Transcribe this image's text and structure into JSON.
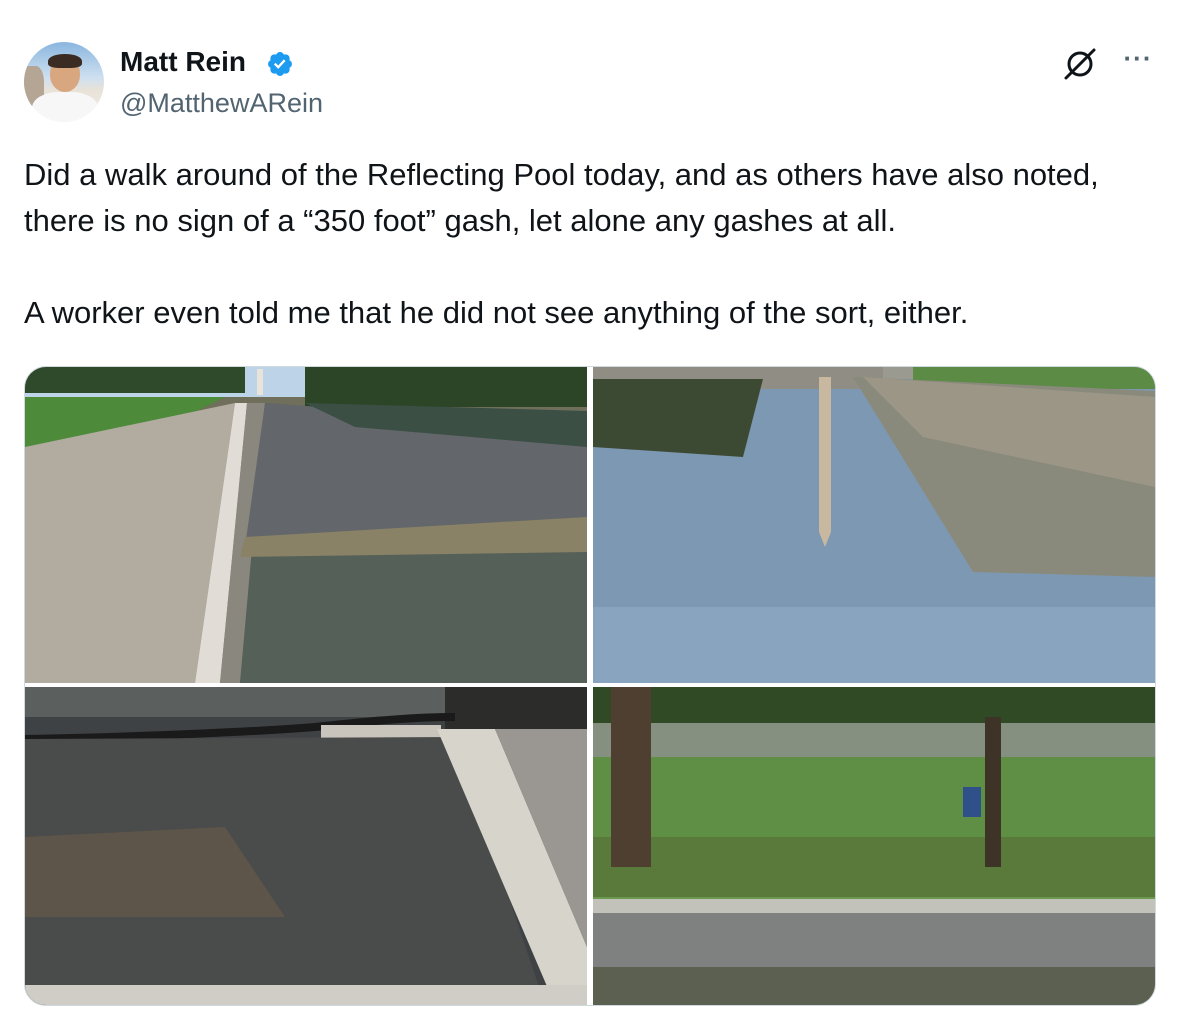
{
  "author": {
    "name": "Matt Rein",
    "handle": "@MatthewARein",
    "verified": true,
    "avatar_icon": "avatar"
  },
  "post": {
    "paragraphs": [
      "Did a walk around of the Reflecting Pool today, and as others have also noted, there is no sign of a “350 foot” gash, let alone any gashes at all.",
      "A worker even told me that he did not see anything of the sort, either."
    ]
  },
  "icons": {
    "verified": "verified-badge-icon",
    "grok": "grok-icon",
    "more": "more-options-icon"
  },
  "colors": {
    "text": "#0f1419",
    "secondary": "#536471",
    "verified_blue": "#1d9bf0",
    "border": "#cfd9de"
  },
  "media": [
    {
      "name": "photo-drained-pool-walkway"
    },
    {
      "name": "photo-pool-monument-reflection"
    },
    {
      "name": "photo-dry-pool-with-hose"
    },
    {
      "name": "photo-lawn-and-fence"
    }
  ]
}
